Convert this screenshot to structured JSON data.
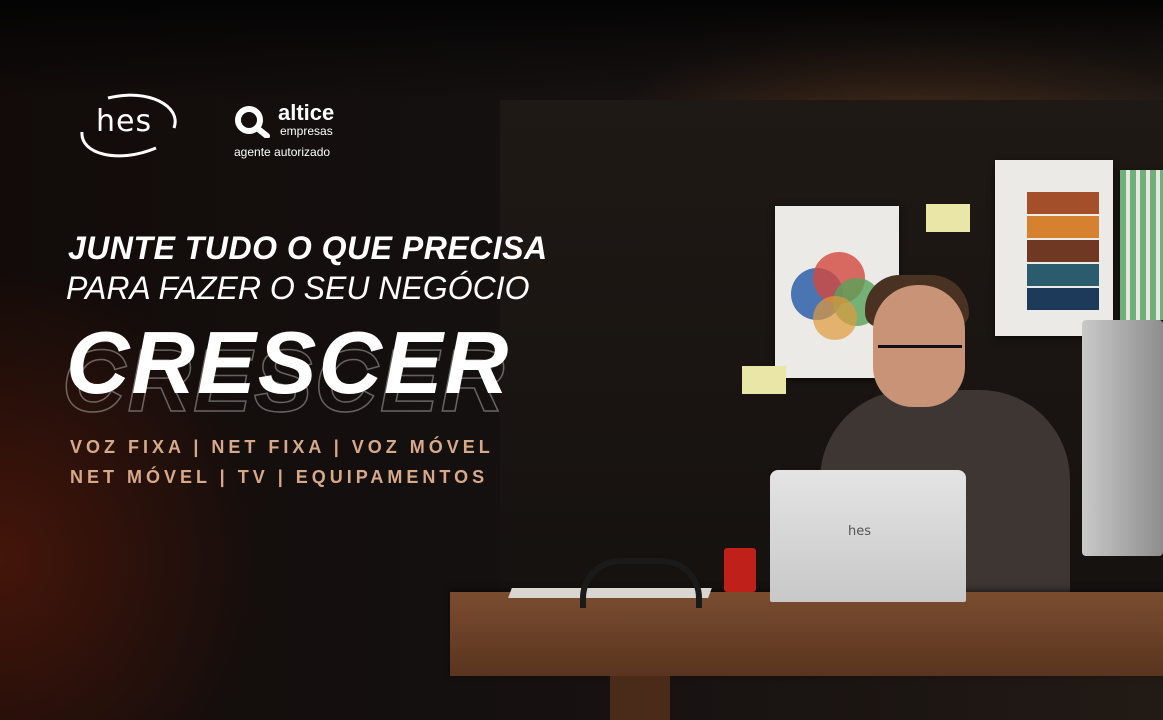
{
  "logos": {
    "hes": "hes",
    "altice_name": "altice",
    "altice_sub": "empresas",
    "altice_agent": "agente autorizado"
  },
  "headline": {
    "line1": "JUNTE TUDO O QUE PRECISA",
    "line2": "PARA FAZER O SEU NEGÓCIO",
    "line3": "CRESCER"
  },
  "services": {
    "line1": "VOZ FIXA | NET FIXA | VOZ MÓVEL",
    "line2": "NET MÓVEL | TV | EQUIPAMENTOS"
  },
  "photo": {
    "laptop_logo": "hes"
  },
  "colors": {
    "accent": "#d7a98a",
    "text": "#ffffff",
    "mug": "#c0201a"
  }
}
